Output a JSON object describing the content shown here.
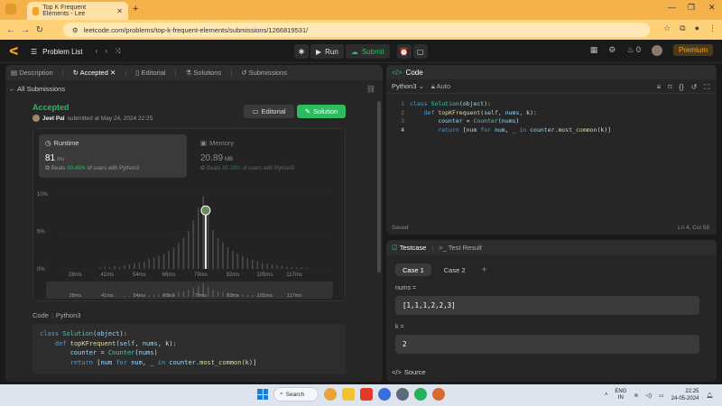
{
  "browser": {
    "tab_title": "Top K Frequent Elements - Lee",
    "url": "leetcode.com/problems/top-k-frequent-elements/submissions/1266819531/"
  },
  "nav": {
    "problem_list": "Problem List",
    "run": "Run",
    "submit": "Submit",
    "streak": "0",
    "premium": "Premium"
  },
  "left": {
    "tabs": [
      "Description",
      "Accepted",
      "Editorial",
      "Solutions",
      "Submissions"
    ],
    "all_submissions": "All Submissions",
    "status": "Accepted",
    "user": "Jeet Pal",
    "submitted_at": "submitted at May 24, 2024 22:25",
    "editorial_btn": "Editorial",
    "solution_btn": "Solution",
    "runtime": {
      "label": "Runtime",
      "value": "81",
      "unit": "ms",
      "beats_pre": "Beats",
      "pct": "90.45%",
      "beats_post": "of users with Python3"
    },
    "memory": {
      "label": "Memory",
      "value": "20.89",
      "unit": "MB",
      "beats_pre": "Beats",
      "pct": "85.29%",
      "beats_post": "of users with Python3"
    },
    "code_label": "Code",
    "code_lang": "Python3"
  },
  "code_lines": [
    "class Solution(object):",
    "    def topKFrequent(self, nums, k):",
    "        counter = Counter(nums)",
    "        return [num for num, _ in counter.most_common(k)]"
  ],
  "right": {
    "code_title": "Code",
    "lang": "Python3",
    "auto": "Auto",
    "saved": "Saved",
    "cursor": "Ln 4, Col 58",
    "testcase_title": "Testcase",
    "test_result": "Test Result",
    "case1": "Case 1",
    "case2": "Case 2",
    "nums_label": "nums =",
    "nums_value": "[1,1,1,2,2,3]",
    "k_label": "k =",
    "k_value": "2",
    "source": "Source"
  },
  "chart_data": {
    "type": "bar",
    "yticks": [
      "10%",
      "5%",
      "0%"
    ],
    "ylim": [
      0,
      10
    ],
    "xticks": [
      "28ms",
      "41ms",
      "54ms",
      "66ms",
      "79ms",
      "92ms",
      "105ms",
      "117ms"
    ],
    "xlim": [
      22,
      132
    ],
    "bar_x": [
      38,
      40,
      42,
      44,
      46,
      48,
      50,
      52,
      54,
      56,
      58,
      60,
      62,
      64,
      66,
      68,
      70,
      72,
      74,
      76,
      78,
      80,
      82,
      84,
      86,
      88,
      90,
      92,
      94,
      96,
      98,
      100,
      102,
      104,
      106,
      108,
      110,
      112,
      114,
      116,
      118,
      120,
      122
    ],
    "values": [
      0.2,
      0.3,
      0.2,
      0.4,
      0.3,
      0.5,
      0.6,
      0.8,
      0.9,
      1.0,
      1.3,
      1.5,
      1.7,
      2.0,
      2.4,
      2.8,
      3.5,
      4.2,
      5.0,
      6.5,
      8.2,
      9.7,
      7.2,
      5.2,
      4.1,
      3.5,
      2.9,
      2.4,
      2.0,
      1.7,
      1.4,
      1.2,
      1.0,
      0.8,
      0.7,
      0.6,
      0.5,
      0.4,
      0.3,
      0.3,
      0.2,
      0.2,
      0.1
    ],
    "highlight_x": 81
  },
  "taskbar": {
    "search": "Search",
    "lang": "ENG",
    "region": "IN",
    "time": "22:25",
    "date": "24-05-2024"
  }
}
